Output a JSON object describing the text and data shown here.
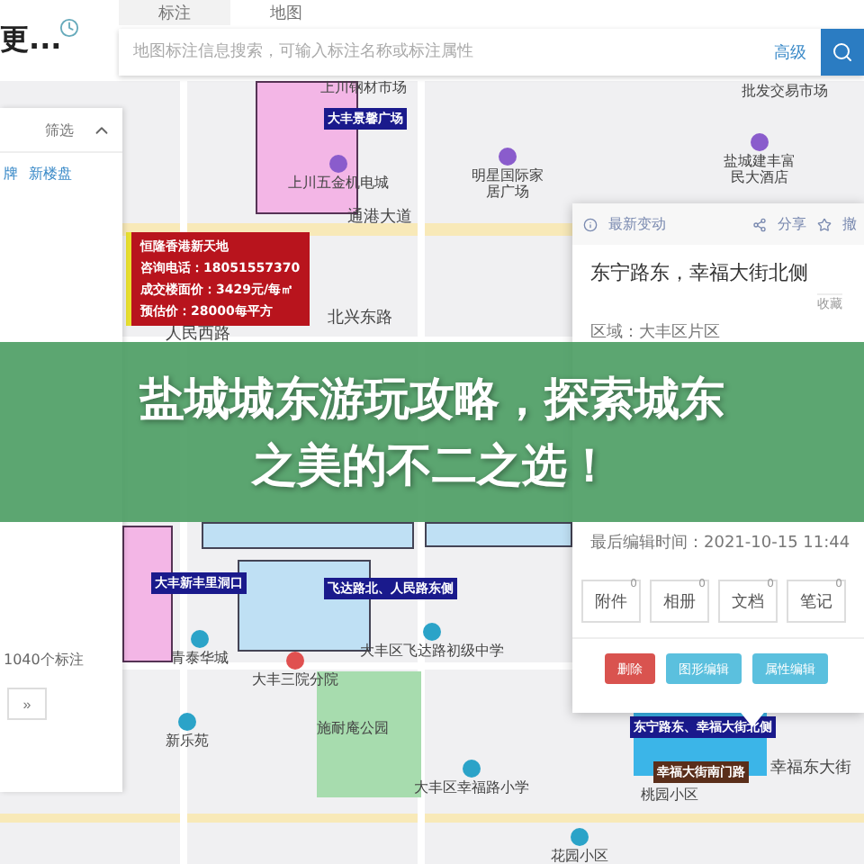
{
  "header": {
    "title": "更...",
    "tabs": [
      {
        "label": "标注",
        "selected": true
      },
      {
        "label": "地图",
        "selected": false
      }
    ],
    "search": {
      "placeholder": "地图标注信息搜索，可输入标注名称或标注属性"
    },
    "advanced": "高级"
  },
  "left_panel": {
    "filter": "筛选",
    "links": [
      "牌",
      "新楼盘"
    ],
    "count": "1040个标注",
    "next": "»"
  },
  "map": {
    "roads": [
      "通港大道",
      "北兴东路",
      "人民西路",
      "幸福东大街"
    ],
    "pois": [
      {
        "name": "上川钢材市场",
        "kind": "text"
      },
      {
        "name": "批发交易市场",
        "kind": "text"
      },
      {
        "name": "上川五金机电城",
        "kind": "shop"
      },
      {
        "name": "明星国际家居广场",
        "kind": "shop"
      },
      {
        "name": "盐城建丰富民大酒店",
        "kind": "shop"
      },
      {
        "name": "青泰华城",
        "kind": "home"
      },
      {
        "name": "大丰区飞达路初级中学",
        "kind": "school"
      },
      {
        "name": "大丰三院分院",
        "kind": "hospital"
      },
      {
        "name": "施耐庵公园",
        "kind": "text"
      },
      {
        "name": "新乐苑",
        "kind": "home"
      },
      {
        "name": "大丰区幸福路小学",
        "kind": "school"
      },
      {
        "name": "桃园小区",
        "kind": "text"
      },
      {
        "name": "花园小区",
        "kind": "home"
      }
    ],
    "tags": [
      {
        "text": "大丰景馨广场",
        "color": "#1a1a8c"
      },
      {
        "text": "大丰新丰里洞口",
        "color": "#1a1a8c"
      },
      {
        "text": "飞达路北、人民路东侧",
        "color": "#1a1a8c"
      },
      {
        "text": "东宁路东、幸福大街北侧",
        "color": "#1a1a8c"
      },
      {
        "text": "幸福大街南门路",
        "color": "#5a2e1a"
      }
    ],
    "info_box": [
      "恒隆香港新天地",
      "咨询电话：18051557370",
      "成交楼面价：3429元/每㎡",
      "预估价：28000每平方"
    ]
  },
  "info_panel": {
    "latest": "最新变动",
    "share": "分享",
    "more": "撤",
    "title": "东宁路东，幸福大街北侧",
    "collect": "收藏",
    "fields": [
      "区域：大丰区片区",
      "最后编辑时间：2021-10-15 11:44"
    ],
    "counters": [
      {
        "label": "附件",
        "count": "0"
      },
      {
        "label": "相册",
        "count": "0"
      },
      {
        "label": "文档",
        "count": "0"
      },
      {
        "label": "笔记",
        "count": "0"
      }
    ],
    "actions": [
      {
        "label": "删除",
        "kind": "danger"
      },
      {
        "label": "图形编辑",
        "kind": "info"
      },
      {
        "label": "属性编辑",
        "kind": "info"
      }
    ]
  },
  "banner": {
    "lines": [
      "盐城城东游玩攻略，探索城东",
      "之美的不二之选！"
    ]
  }
}
